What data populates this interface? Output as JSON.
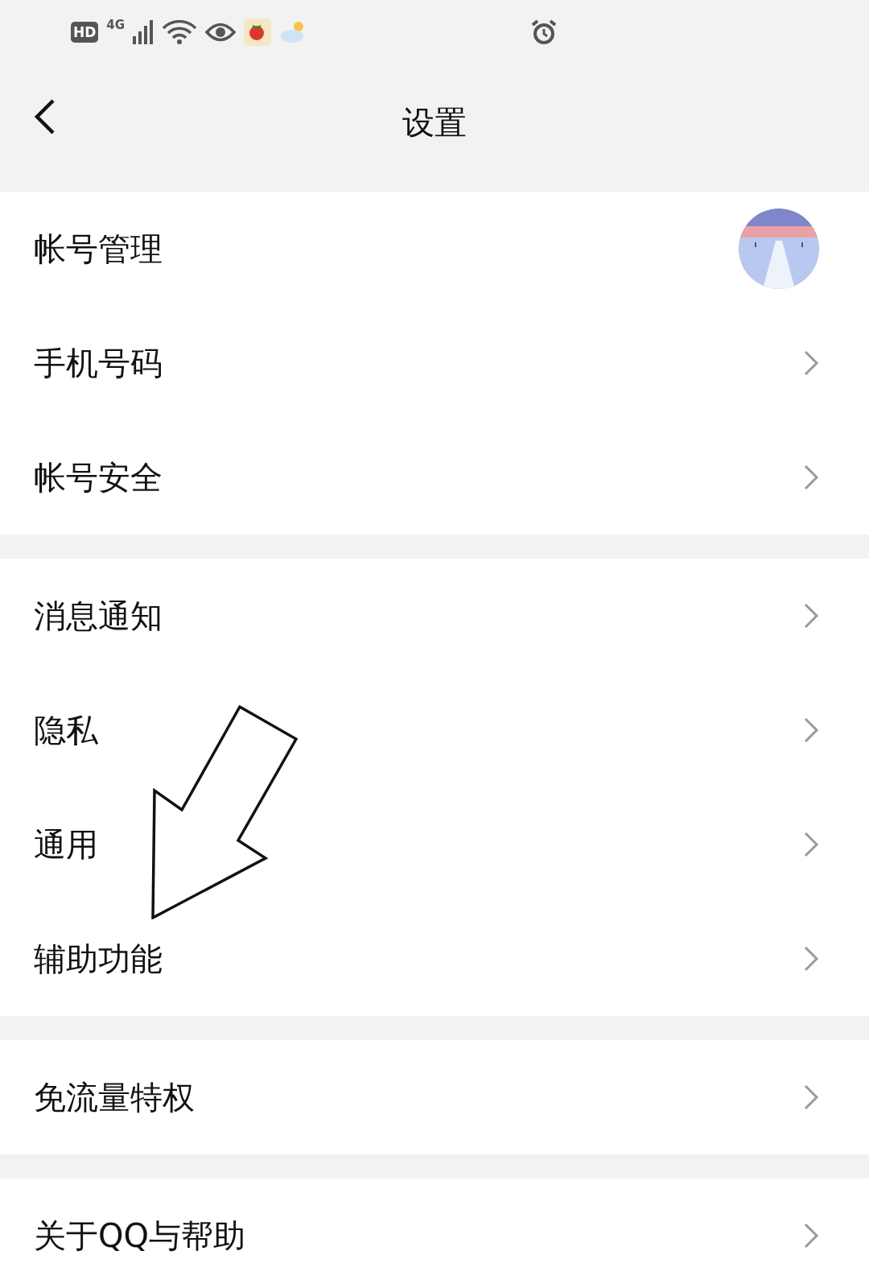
{
  "status_bar": {
    "hd_badge": "HD",
    "network": "4G"
  },
  "header": {
    "title": "设置"
  },
  "sections": [
    {
      "rows": [
        {
          "label": "帐号管理",
          "kind": "avatar"
        },
        {
          "label": "手机号码",
          "kind": "chevron"
        },
        {
          "label": "帐号安全",
          "kind": "chevron"
        }
      ]
    },
    {
      "rows": [
        {
          "label": "消息通知",
          "kind": "chevron"
        },
        {
          "label": "隐私",
          "kind": "chevron"
        },
        {
          "label": "通用",
          "kind": "chevron"
        },
        {
          "label": "辅助功能",
          "kind": "chevron"
        }
      ]
    },
    {
      "rows": [
        {
          "label": "免流量特权",
          "kind": "chevron"
        }
      ]
    },
    {
      "rows": [
        {
          "label": "关于QQ与帮助",
          "kind": "chevron"
        }
      ]
    }
  ]
}
